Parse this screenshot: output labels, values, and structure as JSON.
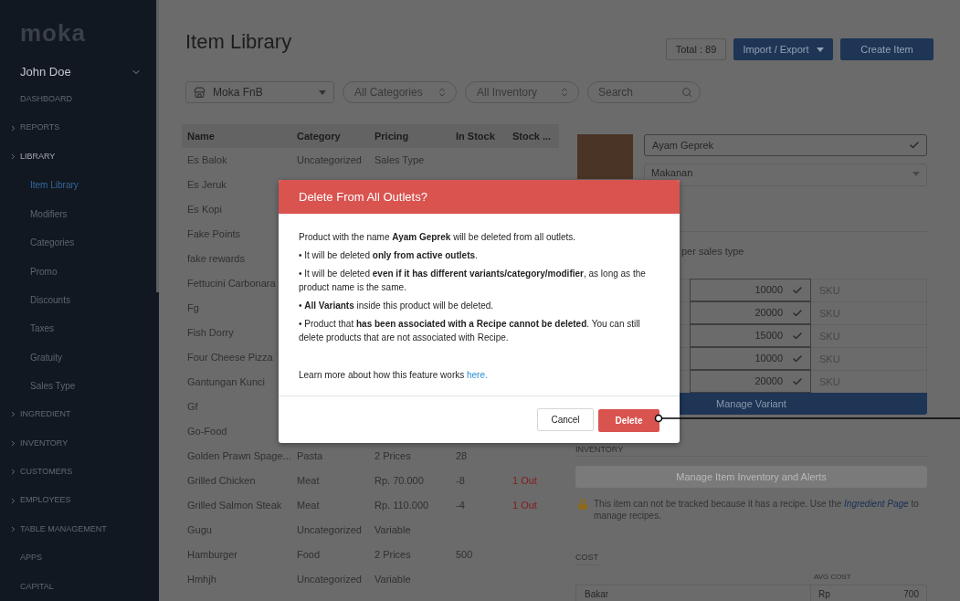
{
  "sidebar": {
    "logo": "moka",
    "user": "John Doe",
    "items": [
      {
        "label": "DASHBOARD",
        "expandable": false,
        "expanded": false,
        "selected": false
      },
      {
        "label": "REPORTS",
        "expandable": true,
        "expanded": false,
        "selected": false
      },
      {
        "label": "LIBRARY",
        "expandable": true,
        "expanded": true,
        "selected": false,
        "children": [
          {
            "label": "Item Library",
            "selected": true
          },
          {
            "label": "Modifiers",
            "selected": false
          },
          {
            "label": "Categories",
            "selected": false
          },
          {
            "label": "Promo",
            "selected": false
          },
          {
            "label": "Discounts",
            "selected": false
          },
          {
            "label": "Taxes",
            "selected": false
          },
          {
            "label": "Gratuity",
            "selected": false
          },
          {
            "label": "Sales Type",
            "selected": false
          }
        ]
      },
      {
        "label": "INGREDIENT",
        "expandable": true,
        "expanded": false,
        "selected": false
      },
      {
        "label": "INVENTORY",
        "expandable": true,
        "expanded": false,
        "selected": false
      },
      {
        "label": "CUSTOMERS",
        "expandable": true,
        "expanded": false,
        "selected": false
      },
      {
        "label": "EMPLOYEES",
        "expandable": true,
        "expanded": false,
        "selected": false
      },
      {
        "label": "TABLE MANAGEMENT",
        "expandable": true,
        "expanded": false,
        "selected": false
      },
      {
        "label": "APPS",
        "expandable": false,
        "expanded": false,
        "selected": false
      },
      {
        "label": "CAPITAL",
        "expandable": false,
        "expanded": false,
        "selected": false
      }
    ]
  },
  "header": {
    "title": "Item Library",
    "total": "Total : 89",
    "import_export": "Import / Export",
    "create": "Create Item"
  },
  "filters": {
    "outlet": "Moka FnB",
    "category": "All Categories",
    "inventory": "All Inventory",
    "search_placeholder": "Search"
  },
  "table": {
    "columns": [
      "Name",
      "Category",
      "Pricing",
      "In Stock",
      "Stock ..."
    ],
    "rows": [
      {
        "cells": [
          "Es Balok",
          "Uncategorized",
          "Sales Type"
        ]
      },
      {
        "cells": [
          "Es Jeruk"
        ]
      },
      {
        "cells": [
          "Es Kopi"
        ]
      },
      {
        "cells": [
          "Fake Points"
        ]
      },
      {
        "cells": [
          "fake rewards"
        ]
      },
      {
        "cells": [
          "Fettucini Carbonara"
        ]
      },
      {
        "cells": [
          "Fg"
        ]
      },
      {
        "cells": [
          "Fish Dorry"
        ]
      },
      {
        "cells": [
          "Four Cheese Pizza"
        ]
      },
      {
        "cells": [
          "Gantungan Kunci"
        ]
      },
      {
        "cells": [
          "Gf"
        ]
      },
      {
        "cells": [
          "Go-Food"
        ]
      },
      {
        "cells": [
          "Golden Prawn Spage...",
          "Pasta",
          "2 Prices",
          "28"
        ]
      },
      {
        "cells": [
          "Grilled Chicken",
          "Meat",
          "Rp. 70.000",
          "-8",
          "1 Out"
        ]
      },
      {
        "cells": [
          "Grilled Salmon Steak",
          "Meat",
          "Rp. 110.000",
          "-4",
          "1 Out"
        ]
      },
      {
        "cells": [
          "Gugu",
          "Uncategorized",
          "Variable"
        ]
      },
      {
        "cells": [
          "Hamburger",
          "Food",
          "2 Prices",
          "500"
        ]
      },
      {
        "cells": [
          "Hmhjh",
          "Uncategorized",
          "Variable"
        ]
      }
    ]
  },
  "detail": {
    "name_value": "Ayam Geprek",
    "category_value": "Makanan",
    "pricing_label": "per sales type",
    "variants": [
      {
        "price": "10000",
        "sku_placeholder": "SKU"
      },
      {
        "price": "20000",
        "sku_placeholder": "SKU"
      },
      {
        "price": "15000",
        "sku_placeholder": "SKU"
      },
      {
        "price": "10000",
        "sku_placeholder": "SKU"
      },
      {
        "price": "20000",
        "sku_placeholder": "SKU"
      }
    ],
    "manage_variant": "Manage Variant",
    "inventory_label": "INVENTORY",
    "inventory_button": {
      "label": "Manage Item Inventory and Alerts",
      "disabled": true
    },
    "recipe_note": {
      "before": "This item can not be tracked because it has a recipe. Use the",
      "link": "Ingredient Page",
      "after": "to manage recipes."
    },
    "cost_label": "COST",
    "avg_cost_label": "AVG COST",
    "cost_rows": [
      {
        "name": "Bakar",
        "currency": "Rp",
        "avg_cost": "700"
      }
    ]
  },
  "modal": {
    "title": "Delete From All Outlets?",
    "paragraphs": [
      "Product with the name **Ayam Geprek** will be deleted from all outlets.",
      "• It will be deleted **only from active outlets**.",
      "• It will be deleted **even if it has different variants/category/modifier**, as long as the product name is the same.",
      "• **All Variants** inside this product will be deleted.",
      "• Product that **has been associated with a Recipe cannot be deleted**. You can still delete products that are not associated with Recipe."
    ],
    "learn_more": {
      "text": "Learn more about how this feature works",
      "link": "here."
    },
    "cancel": "Cancel",
    "delete": "Delete"
  }
}
